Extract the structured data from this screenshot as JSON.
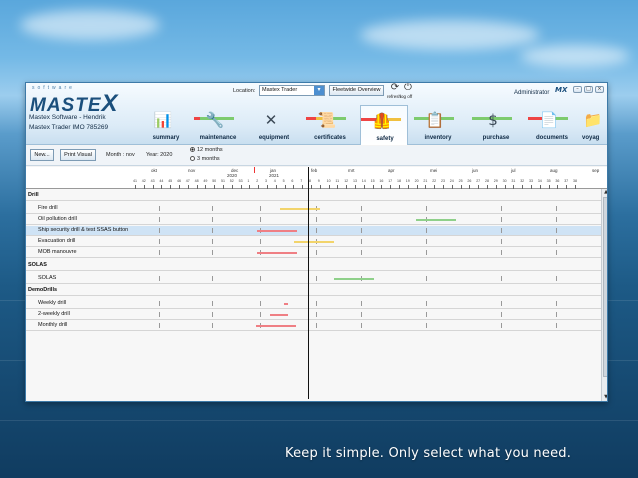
{
  "header": {
    "logo_small": "software",
    "logo_text": "MASTE",
    "logo_x": "X",
    "company_line": "Mastex Software - Hendrik",
    "vessel_line": "Mastex Trader  IMO 785269",
    "location_label": "Location:",
    "location_value": "Mastex Trader",
    "fleetwide_label": "Fleetwide Overview",
    "refresh_label": "refresh",
    "logoff_label": "log off",
    "user_label": "Administrator",
    "mini_logo": "MX"
  },
  "modules": [
    {
      "id": "summary",
      "label": "summary",
      "icon": "bar-chart-icon",
      "glyph": "📊"
    },
    {
      "id": "maintenance",
      "label": "maintenance",
      "icon": "wrench-icon",
      "glyph": "🔧"
    },
    {
      "id": "equipment",
      "label": "equipment",
      "icon": "tools-icon",
      "glyph": "✕"
    },
    {
      "id": "certificates",
      "label": "certificates",
      "icon": "certificate-icon",
      "glyph": "📜"
    },
    {
      "id": "safety",
      "label": "safety",
      "icon": "life-vest-icon",
      "glyph": "🦺"
    },
    {
      "id": "inventory",
      "label": "inventory",
      "icon": "inventory-icon",
      "glyph": "📋"
    },
    {
      "id": "purchase",
      "label": "purchase",
      "icon": "dollar-icon",
      "glyph": "$"
    },
    {
      "id": "documents",
      "label": "documents",
      "icon": "documents-icon",
      "glyph": "📄"
    },
    {
      "id": "voyage",
      "label": "voyag",
      "icon": "voyage-icon",
      "glyph": "📁"
    }
  ],
  "toolbar": {
    "new_label": "New...",
    "print_label": "Print Visual",
    "month_label": "Month : nov",
    "year_label": "Year: 2020",
    "radio_12": "12 months",
    "radio_3": "3 months"
  },
  "timeline": {
    "years": [
      "2020",
      "2021"
    ],
    "months": [
      "okt",
      "nov",
      "dec",
      "jan",
      "feb",
      "mrt",
      "apr",
      "mei",
      "jun",
      "jul",
      "aug",
      "sep"
    ],
    "weeks": [
      "41",
      "42",
      "43",
      "44",
      "45",
      "46",
      "47",
      "48",
      "49",
      "50",
      "51",
      "52",
      "53",
      "1",
      "2",
      "3",
      "4",
      "5",
      "6",
      "7",
      "8",
      "9",
      "10",
      "11",
      "12",
      "13",
      "14",
      "15",
      "16",
      "17",
      "18",
      "19",
      "20",
      "21",
      "22",
      "23",
      "24",
      "25",
      "26",
      "27",
      "28",
      "29",
      "30",
      "31",
      "32",
      "33",
      "34",
      "35",
      "36",
      "37",
      "38"
    ]
  },
  "rows": [
    {
      "type": "group",
      "name": "Drill"
    },
    {
      "type": "item",
      "name": "Fire drill"
    },
    {
      "type": "item",
      "name": "Oil pollution drill"
    },
    {
      "type": "item",
      "name": "Ship security drill & test SSAS button"
    },
    {
      "type": "item",
      "name": "Evacuation drill"
    },
    {
      "type": "item",
      "name": "MOB manouvre"
    },
    {
      "type": "group",
      "name": "SOLAS"
    },
    {
      "type": "item",
      "name": "SOLAS"
    },
    {
      "type": "group",
      "name": "DemoDrills"
    },
    {
      "type": "item",
      "name": "Weekly drill"
    },
    {
      "type": "item",
      "name": "2-weekly drill"
    },
    {
      "type": "item",
      "name": "Monthly drill"
    }
  ],
  "colors": {
    "overdue": "#ef7f84",
    "due_soon": "#f2d46b",
    "ok": "#8fd08a"
  },
  "tagline": "Keep it simple. Only select what you need."
}
